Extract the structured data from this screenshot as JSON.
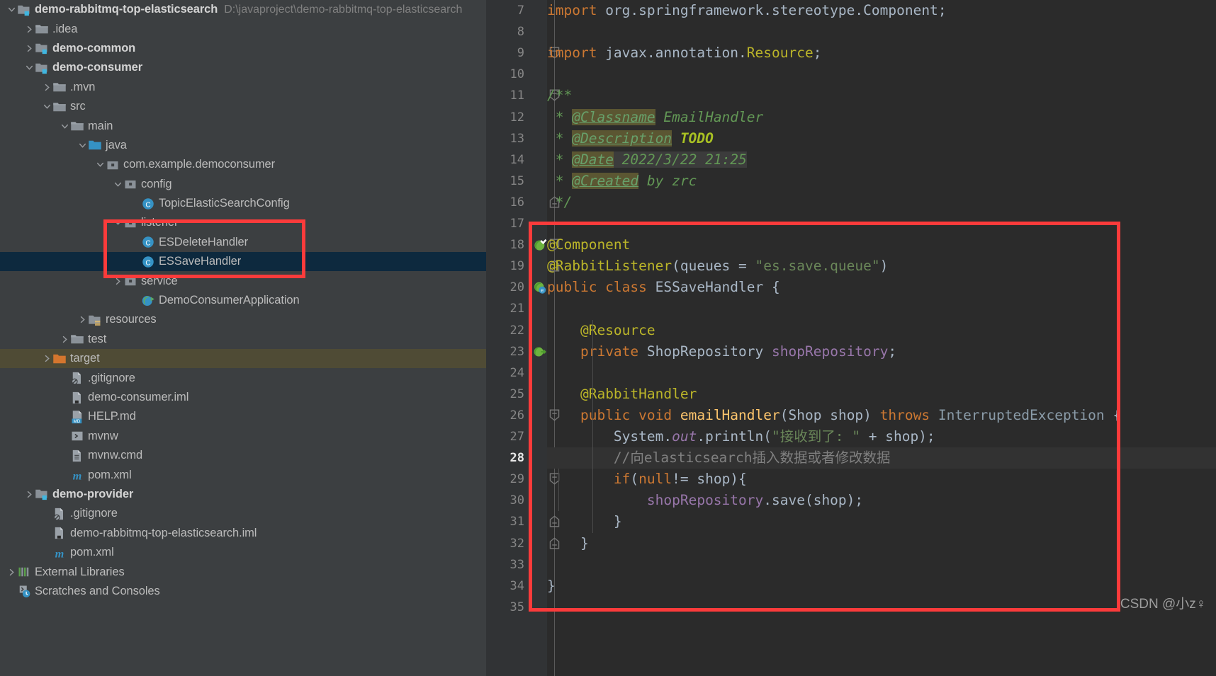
{
  "project": {
    "root_label": "demo-rabbitmq-top-elasticsearch",
    "root_path": "D:\\javaproject\\demo-rabbitmq-top-elasticsearch",
    "items": [
      {
        "label": ".idea",
        "indent": 1,
        "icon": "folder",
        "arrow": "collapsed",
        "bold": false
      },
      {
        "label": "demo-common",
        "indent": 1,
        "icon": "module",
        "arrow": "collapsed",
        "bold": true
      },
      {
        "label": "demo-consumer",
        "indent": 1,
        "icon": "module",
        "arrow": "expanded",
        "bold": true
      },
      {
        "label": ".mvn",
        "indent": 2,
        "icon": "folder",
        "arrow": "collapsed",
        "bold": false
      },
      {
        "label": "src",
        "indent": 2,
        "icon": "folder",
        "arrow": "expanded",
        "bold": false
      },
      {
        "label": "main",
        "indent": 3,
        "icon": "folder",
        "arrow": "expanded",
        "bold": false
      },
      {
        "label": "java",
        "indent": 4,
        "icon": "source-root",
        "arrow": "expanded",
        "bold": false
      },
      {
        "label": "com.example.democonsumer",
        "indent": 5,
        "icon": "package",
        "arrow": "expanded",
        "bold": false
      },
      {
        "label": "config",
        "indent": 6,
        "icon": "package",
        "arrow": "expanded",
        "bold": false
      },
      {
        "label": "TopicElasticSearchConfig",
        "indent": 7,
        "icon": "class",
        "arrow": "none",
        "bold": false
      },
      {
        "label": "listener",
        "indent": 6,
        "icon": "package",
        "arrow": "expanded",
        "bold": false
      },
      {
        "label": "ESDeleteHandler",
        "indent": 7,
        "icon": "class",
        "arrow": "none",
        "bold": false
      },
      {
        "label": "ESSaveHandler",
        "indent": 7,
        "icon": "class",
        "arrow": "none",
        "bold": false,
        "state": "selected"
      },
      {
        "label": "service",
        "indent": 6,
        "icon": "package",
        "arrow": "collapsed",
        "bold": false
      },
      {
        "label": "DemoConsumerApplication",
        "indent": 7,
        "icon": "spring-class",
        "arrow": "none",
        "bold": false
      },
      {
        "label": "resources",
        "indent": 4,
        "icon": "resources",
        "arrow": "collapsed",
        "bold": false
      },
      {
        "label": "test",
        "indent": 3,
        "icon": "folder",
        "arrow": "collapsed",
        "bold": false
      },
      {
        "label": "target",
        "indent": 2,
        "icon": "target",
        "arrow": "collapsed",
        "bold": false,
        "state": "highlight"
      },
      {
        "label": ".gitignore",
        "indent": 3,
        "icon": "gitignore",
        "arrow": "none",
        "bold": false
      },
      {
        "label": "demo-consumer.iml",
        "indent": 3,
        "icon": "iml",
        "arrow": "none",
        "bold": false
      },
      {
        "label": "HELP.md",
        "indent": 3,
        "icon": "md",
        "arrow": "none",
        "bold": false
      },
      {
        "label": "mvnw",
        "indent": 3,
        "icon": "shell",
        "arrow": "none",
        "bold": false
      },
      {
        "label": "mvnw.cmd",
        "indent": 3,
        "icon": "cmd",
        "arrow": "none",
        "bold": false
      },
      {
        "label": "pom.xml",
        "indent": 3,
        "icon": "maven",
        "arrow": "none",
        "bold": false
      },
      {
        "label": "demo-provider",
        "indent": 1,
        "icon": "module",
        "arrow": "collapsed",
        "bold": true
      },
      {
        "label": ".gitignore",
        "indent": 2,
        "icon": "gitignore",
        "arrow": "none",
        "bold": false
      },
      {
        "label": "demo-rabbitmq-top-elasticsearch.iml",
        "indent": 2,
        "icon": "iml",
        "arrow": "none",
        "bold": false
      },
      {
        "label": "pom.xml",
        "indent": 2,
        "icon": "maven",
        "arrow": "none",
        "bold": false
      },
      {
        "label": "External Libraries",
        "indent": 0,
        "icon": "libraries",
        "arrow": "collapsed",
        "bold": false
      },
      {
        "label": "Scratches and Consoles",
        "indent": 0,
        "icon": "scratches",
        "arrow": "none",
        "bold": false
      }
    ]
  },
  "editor": {
    "first_line": 7,
    "cursor_line": 28,
    "lines": [
      {
        "n": 7,
        "html": "<span class='kw'>import</span> org.springframework.stereotype.<span class='typ' style='color:#a9b7c6'>Component</span><span>;</span>"
      },
      {
        "n": 8,
        "html": ""
      },
      {
        "n": 9,
        "html": "<span class='kw'>import</span> javax.annotation.<span class='ann'>Resource</span>;"
      },
      {
        "n": 10,
        "html": ""
      },
      {
        "n": 11,
        "html": "<span class='doc'>/**</span>"
      },
      {
        "n": 12,
        "html": "<span class='doc'> * </span><span class='doctag'>@Classname</span><span class='docval'> EmailHandler</span>"
      },
      {
        "n": 13,
        "html": "<span class='doc'> * </span><span class='doctag'>@Description</span><span class='docval'> </span><span class='todo'>TODO</span>"
      },
      {
        "n": 14,
        "html": "<span class='doc'> * </span><span class='doctag'>@Date</span><span class='docval-hl'> 2022/3/22 21:25</span>"
      },
      {
        "n": 15,
        "html": "<span class='doc'> * </span><span class='doctag'>@Created</span><span class='docval'> by zrc</span>"
      },
      {
        "n": 16,
        "html": "<span class='doc'> */</span>"
      },
      {
        "n": 17,
        "html": ""
      },
      {
        "n": 18,
        "html": "<span class='ann'>@Component</span>"
      },
      {
        "n": 19,
        "html": "<span class='ann'>@RabbitListener</span><span>(queues = </span><span class='str'>\"es.save.queue\"</span><span>)</span>"
      },
      {
        "n": 20,
        "html": "<span class='kw'>public class </span><span class='typ'>ESSaveHandler</span><span> {</span>"
      },
      {
        "n": 21,
        "html": ""
      },
      {
        "n": 22,
        "html": "    <span class='ann'>@Resource</span>"
      },
      {
        "n": 23,
        "html": "    <span class='kw'>private</span> <span class='typ'>ShopRepository</span> <span class='fld'>shopRepository</span>;"
      },
      {
        "n": 24,
        "html": ""
      },
      {
        "n": 25,
        "html": "    <span class='ann'>@RabbitHandler</span>"
      },
      {
        "n": 26,
        "html": "    <span class='kw'>public void </span><span class='mth'>emailHandler</span><span>(</span><span class='typ'>Shop</span><span> shop) </span><span class='kw'>throws</span><span class='typ' style='color:#8a9ba8'> InterruptedException</span><span> {</span>"
      },
      {
        "n": 27,
        "html": "        <span class='typ'>System</span>.<span class='stat'>out</span>.<span>println(</span><span class='str'>\"接收到了: \"</span><span> + shop);</span>"
      },
      {
        "n": 28,
        "html": "        <span class='cmt'>//向elasticsearch插入数据或者修改数据</span>"
      },
      {
        "n": 29,
        "html": "        <span class='kw'>if</span>(<span class='kw'>null</span>!= shop){"
      },
      {
        "n": 30,
        "html": "            <span class='fld'>shopRepository</span>.save(shop);"
      },
      {
        "n": 31,
        "html": "        }"
      },
      {
        "n": 32,
        "html": "    }"
      },
      {
        "n": 33,
        "html": ""
      },
      {
        "n": 34,
        "html": "}"
      },
      {
        "n": 35,
        "html": ""
      }
    ],
    "gutter_icons": [
      {
        "line": 18,
        "type": "spring-bean-check"
      },
      {
        "line": 20,
        "type": "spring-bean-e"
      },
      {
        "line": 23,
        "type": "spring-bean-arrow"
      }
    ],
    "fold_marks": [
      {
        "line": 9,
        "type": "fold-top"
      },
      {
        "line": 11,
        "type": "fold-top"
      },
      {
        "line": 16,
        "type": "fold-bottom"
      },
      {
        "line": 18,
        "type": "fold-top"
      },
      {
        "line": 19,
        "type": "fold-bottom"
      },
      {
        "line": 26,
        "type": "fold-top"
      },
      {
        "line": 29,
        "type": "fold-top"
      },
      {
        "line": 31,
        "type": "fold-bottom"
      },
      {
        "line": 32,
        "type": "fold-bottom"
      }
    ]
  },
  "annotations": {
    "tree_box_label": "red-highlight-box-listener",
    "editor_box_label": "red-highlight-box-class-body",
    "watermark": "CSDN @小z♀"
  },
  "colors": {
    "accent_red": "#fb3b3b",
    "selection_blue": "#0d293e",
    "target_highlight": "#4f4b35",
    "editor_bg": "#2b2b2b",
    "gutter_bg": "#313335",
    "tree_bg": "#3c3f41"
  }
}
